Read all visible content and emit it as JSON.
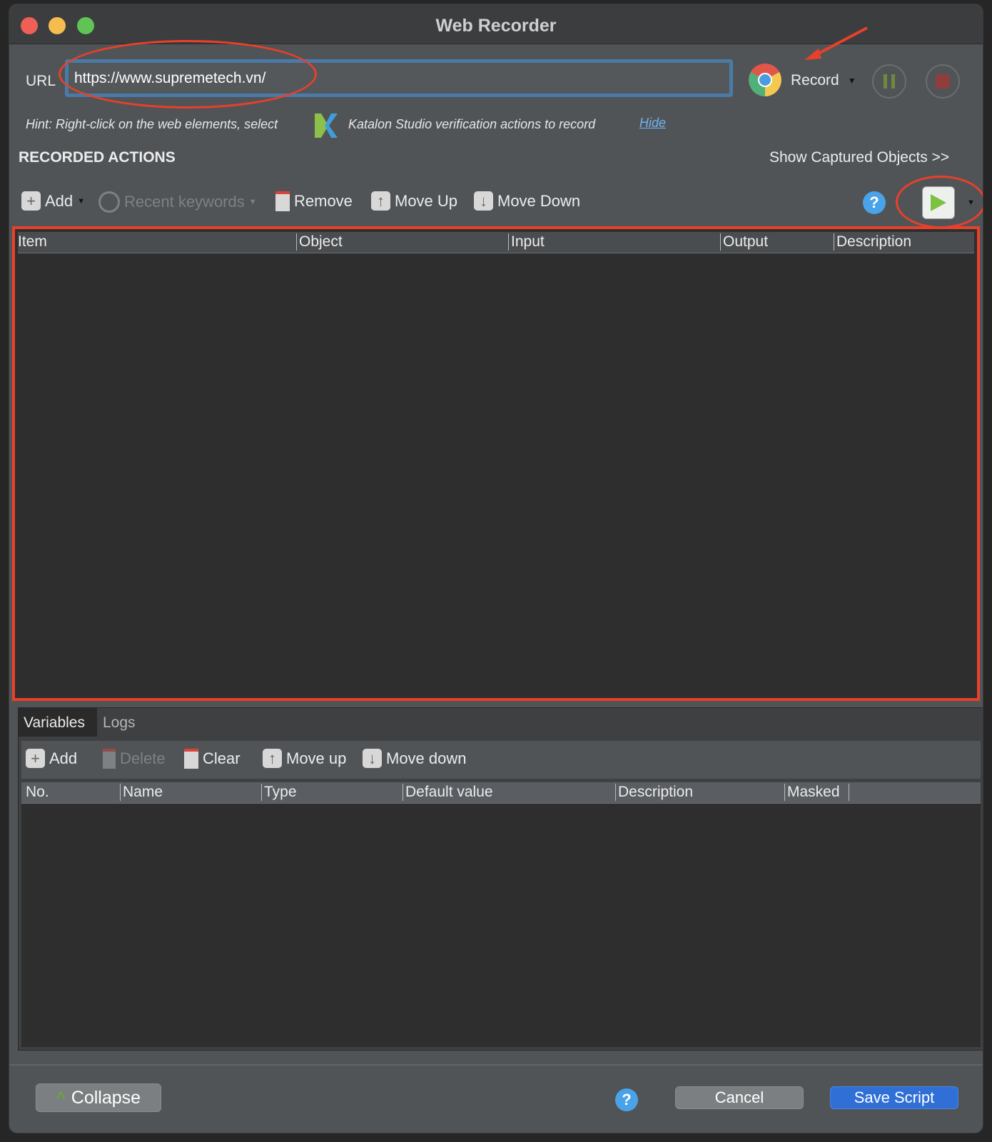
{
  "window": {
    "title": "Web Recorder"
  },
  "url": {
    "label": "URL",
    "value": "https://www.supremetech.vn/"
  },
  "record": {
    "label": "Record",
    "browser_icon": "chrome-icon"
  },
  "hint": {
    "prefix": "Hint: Right-click on the web elements, select",
    "suffix": "Katalon Studio verification actions to record",
    "hide_link": "Hide"
  },
  "recorded": {
    "title": "RECORDED ACTIONS",
    "show_captured": "Show Captured Objects >>",
    "toolbar": {
      "add": "Add",
      "recent": "Recent keywords",
      "remove": "Remove",
      "move_up": "Move Up",
      "move_down": "Move Down"
    },
    "columns": [
      "Item",
      "Object",
      "Input",
      "Output",
      "Description"
    ]
  },
  "bottom_tabs": [
    "Variables",
    "Logs"
  ],
  "variables": {
    "toolbar": {
      "add": "Add",
      "delete": "Delete",
      "clear": "Clear",
      "move_up": "Move up",
      "move_down": "Move down"
    },
    "columns": [
      "No.",
      "Name",
      "Type",
      "Default value",
      "Description",
      "Masked"
    ]
  },
  "footer": {
    "collapse": "Collapse",
    "cancel": "Cancel",
    "save": "Save Script"
  },
  "colors": {
    "accent": "#2f6fd6",
    "annotation": "#e8402a",
    "play": "#7cc142"
  }
}
